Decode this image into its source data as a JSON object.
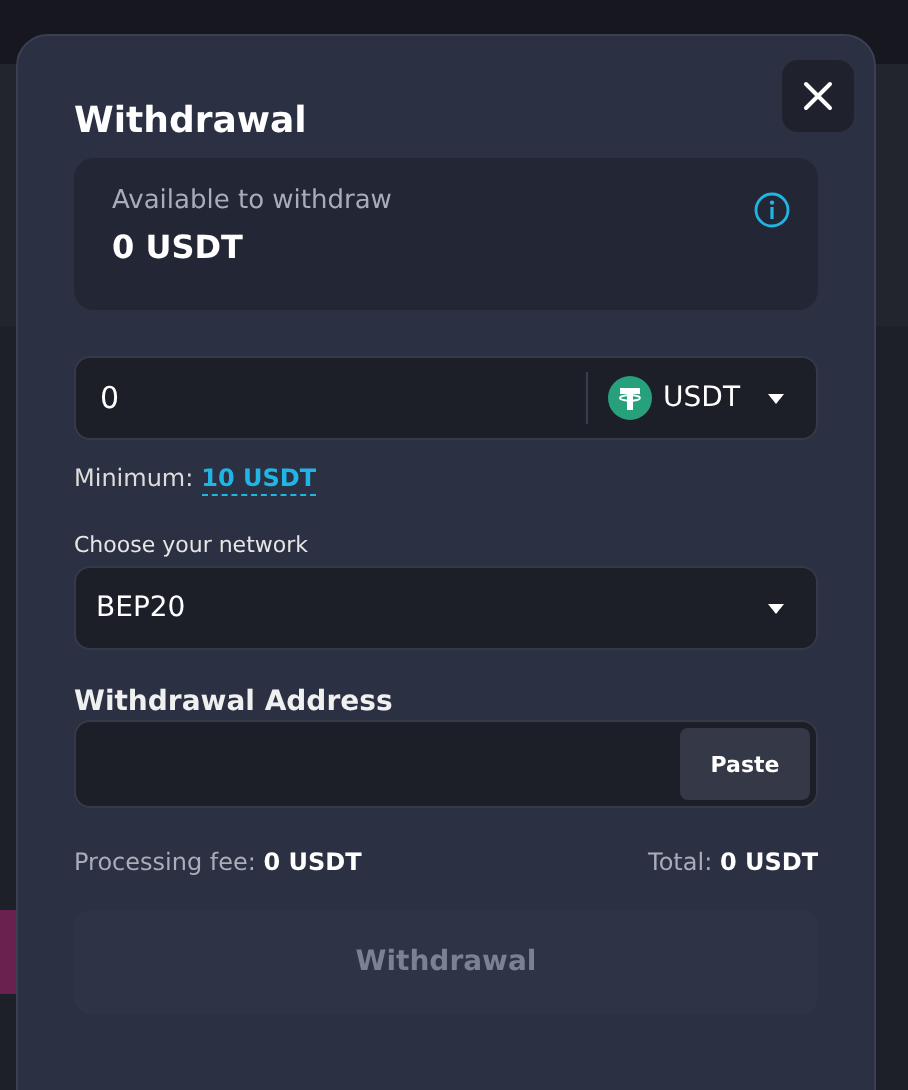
{
  "dialog": {
    "title": "Withdrawal",
    "balance": {
      "label": "Available to withdraw",
      "value": "0 USDT"
    },
    "amount": {
      "value": "0",
      "currency": "USDT"
    },
    "minimum": {
      "label": "Minimum:",
      "value": "10 USDT"
    },
    "network": {
      "label": "Choose your network",
      "value": "BEP20"
    },
    "address": {
      "label": "Withdrawal Address",
      "paste_button": "Paste"
    },
    "fee": {
      "label": "Processing fee:",
      "value": "0 USDT"
    },
    "total": {
      "label": "Total:",
      "value": "0 USDT"
    },
    "submit": {
      "label": "Withdrawal",
      "disabled": true
    }
  }
}
